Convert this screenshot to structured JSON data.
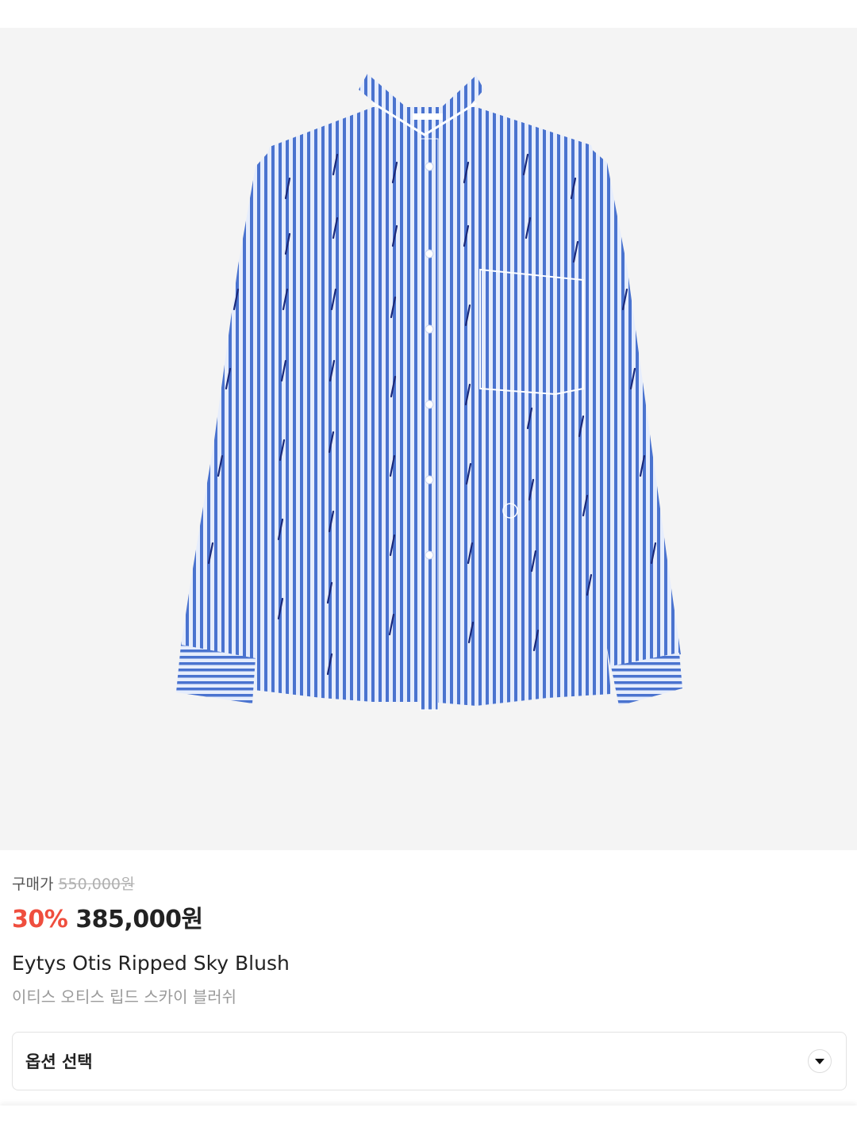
{
  "product": {
    "image_alt": "Eytys Otis Ripped Sky Blush",
    "shirt_colors": {
      "base": "#dfe8fb",
      "stripe": "#3f6ccc",
      "rip": "#1b2a7a"
    }
  },
  "price": {
    "purchase_label": "구매가",
    "original_price": "550,000원",
    "discount": "30%",
    "sale_price": "385,000원"
  },
  "name": {
    "english": "Eytys Otis Ripped Sky Blush",
    "korean": "이티스 오티스 립드 스카이 블러쉬"
  },
  "option": {
    "label": "옵션 선택",
    "icon": "chevron-down-icon"
  },
  "colors": {
    "discount": "#ef4e3e",
    "hero_bg": "#f4f4f4"
  }
}
